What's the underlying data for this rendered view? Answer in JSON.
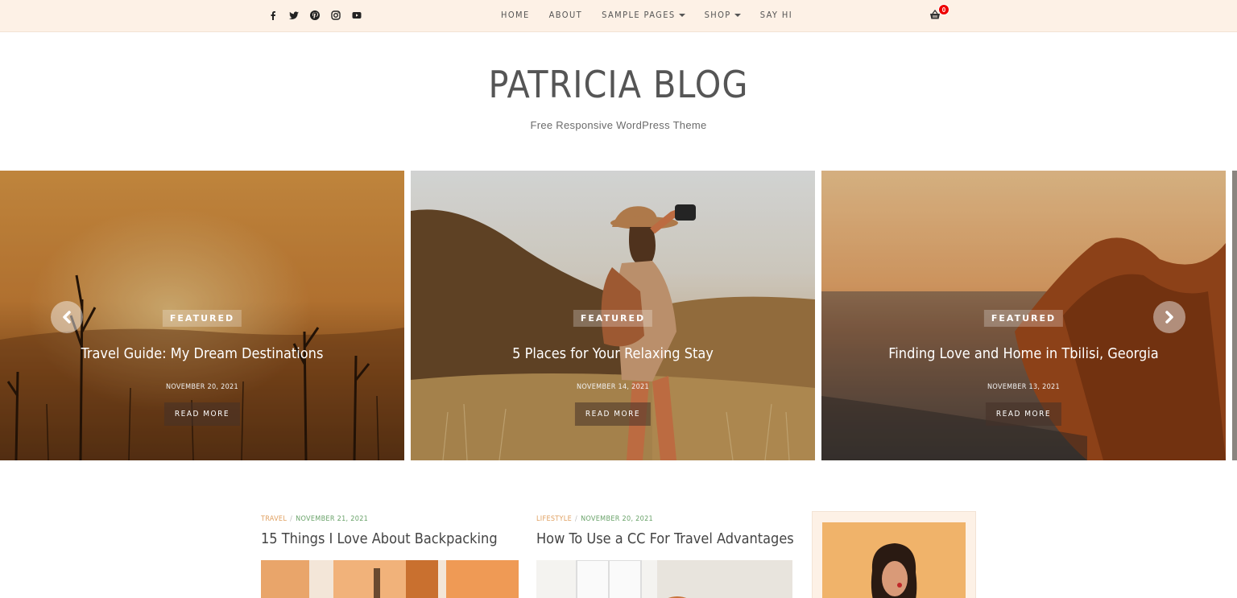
{
  "topbar": {
    "social": [
      {
        "name": "facebook-icon"
      },
      {
        "name": "twitter-icon"
      },
      {
        "name": "pinterest-icon"
      },
      {
        "name": "instagram-icon"
      },
      {
        "name": "youtube-icon"
      }
    ],
    "nav": [
      {
        "label": "HOME",
        "has_caret": false
      },
      {
        "label": "ABOUT",
        "has_caret": false
      },
      {
        "label": "SAMPLE PAGES",
        "has_caret": true
      },
      {
        "label": "SHOP",
        "has_caret": true
      },
      {
        "label": "SAY HI",
        "has_caret": false
      }
    ],
    "cart_count": "0"
  },
  "header": {
    "title": "PATRICIA BLOG",
    "tagline": "Free Responsive WordPress Theme"
  },
  "slider": {
    "slides": [
      {
        "badge": "FEATURED",
        "title": "Travel Guide: My Dream Destinations",
        "date": "NOVEMBER 20, 2021",
        "button": "READ MORE"
      },
      {
        "badge": "FEATURED",
        "title": "5 Places for Your Relaxing Stay",
        "date": "NOVEMBER 14, 2021",
        "button": "READ MORE"
      },
      {
        "badge": "FEATURED",
        "title": "Finding Love and Home in Tbilisi, Georgia",
        "date": "NOVEMBER 13, 2021",
        "button": "READ MORE"
      }
    ]
  },
  "posts": [
    {
      "category": "TRAVEL",
      "date": "NOVEMBER 21, 2021",
      "title": "15 Things I Love About Backpacking"
    },
    {
      "category": "LIFESTYLE",
      "date": "NOVEMBER 20, 2021",
      "title": "How To Use a CC For Travel Advantages"
    }
  ],
  "colors": {
    "topbar_bg": "#fdf1e6",
    "accent_category": "#e0a060",
    "accent_date": "#6aa36a",
    "cart_badge": "#ee0000"
  }
}
